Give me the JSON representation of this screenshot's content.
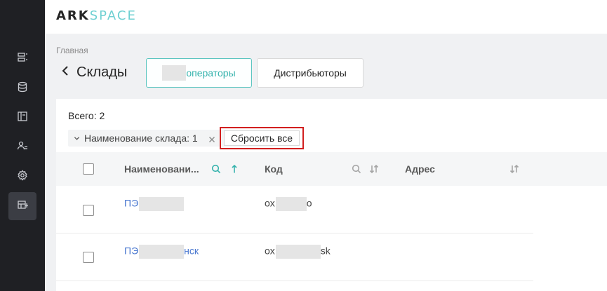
{
  "app": {
    "logo_part1": "ARK",
    "logo_part2": "SPACE"
  },
  "sidebar": {
    "items": [
      {
        "icon": "list-icon"
      },
      {
        "icon": "database-icon"
      },
      {
        "icon": "layout-icon"
      },
      {
        "icon": "users-icon"
      },
      {
        "icon": "settings-icon"
      },
      {
        "icon": "table-icon",
        "active": true
      }
    ]
  },
  "breadcrumb": "Главная",
  "page_title": "Склады",
  "tabs": [
    {
      "label": "операторы",
      "active": true
    },
    {
      "label": "Дистрибьюторы",
      "active": false
    }
  ],
  "summary": {
    "total": "Всего: 2"
  },
  "filter": {
    "label": "Наименование склада: 1",
    "reset_label": "Сбросить все"
  },
  "table": {
    "columns": [
      "Наименовани...",
      "Код",
      "Адрес"
    ],
    "rows": [
      {
        "name_prefix": "ПЭ",
        "name_suffix": "",
        "code_prefix": "ox",
        "code_suffix": "o",
        "address": ""
      },
      {
        "name_prefix": "ПЭ",
        "name_suffix": "нск",
        "code_prefix": "ox",
        "code_suffix": "sk",
        "address": ""
      }
    ]
  },
  "colors": {
    "accent": "#36b3ad",
    "sidebar": "#1f2024",
    "link": "#4a78d0",
    "highlight": "#d21f1f"
  }
}
